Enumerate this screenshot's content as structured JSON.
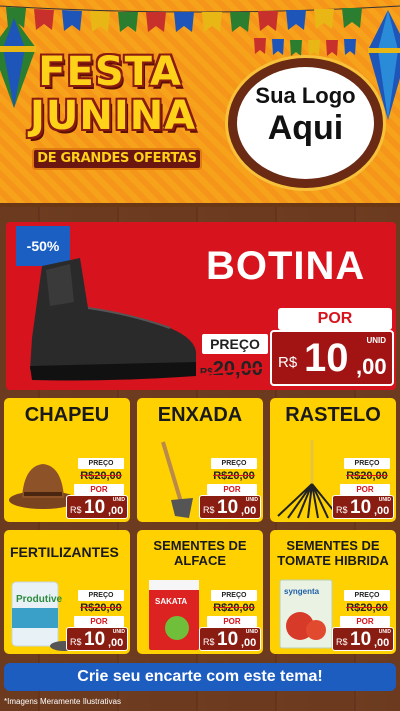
{
  "header": {
    "title_line1": "FESTA",
    "title_line2": "JUNINA",
    "subtitle": "DE GRANDES OFERTAS",
    "logo_line1": "Sua Logo",
    "logo_line2": "Aqui"
  },
  "hero": {
    "discount": "-50%",
    "title": "BOTINA",
    "preco_label": "PREÇO",
    "old_currency": "R$",
    "old_price": "20,00",
    "por_label": "POR",
    "currency": "R$",
    "price_int": "10",
    "price_dec": ",00",
    "unit": "UNID"
  },
  "cards": [
    {
      "name": "CHAPEU",
      "icon": "cowboy-hat-icon",
      "preco_label": "PREÇO",
      "old_price": "R$20,00",
      "por_label": "POR",
      "currency": "R$",
      "price_int": "10",
      "price_dec": ",00",
      "unit": "UNID"
    },
    {
      "name": "ENXADA",
      "icon": "hoe-icon",
      "preco_label": "PREÇO",
      "old_price": "R$20,00",
      "por_label": "POR",
      "currency": "R$",
      "price_int": "10",
      "price_dec": ",00",
      "unit": "UNID"
    },
    {
      "name": "RASTELO",
      "icon": "rake-icon",
      "preco_label": "PREÇO",
      "old_price": "R$20,00",
      "por_label": "POR",
      "currency": "R$",
      "price_int": "10",
      "price_dec": ",00",
      "unit": "UNID"
    },
    {
      "name": "FERTILIZANTES",
      "icon": "fertilizer-bag-icon",
      "bag_text": "Produtive",
      "preco_label": "PREÇO",
      "old_price": "R$20,00",
      "por_label": "POR",
      "currency": "R$",
      "price_int": "10",
      "price_dec": ",00",
      "unit": "UNID"
    },
    {
      "name": "SEMENTES DE ALFACE",
      "icon": "seed-packet-icon",
      "bag_text": "SAKATA",
      "preco_label": "PREÇO",
      "old_price": "R$20,00",
      "por_label": "POR",
      "currency": "R$",
      "price_int": "10",
      "price_dec": ",00",
      "unit": "UNID"
    },
    {
      "name": "SEMENTES DE TOMATE HIBRIDA",
      "icon": "tomato-seed-packet-icon",
      "bag_text": "syngenta",
      "preco_label": "PREÇO",
      "old_price": "R$20,00",
      "por_label": "POR",
      "currency": "R$",
      "price_int": "10",
      "price_dec": ",00",
      "unit": "UNID"
    }
  ],
  "cta": "Crie seu encarte com este tema!",
  "footnote": "*Imagens Meramente Ilustrativas",
  "colors": {
    "hero_bg": "#d7141e",
    "card_bg": "#ffd100",
    "cta_bg": "#1e5dc0",
    "discount_bg": "#1b5fc3"
  }
}
